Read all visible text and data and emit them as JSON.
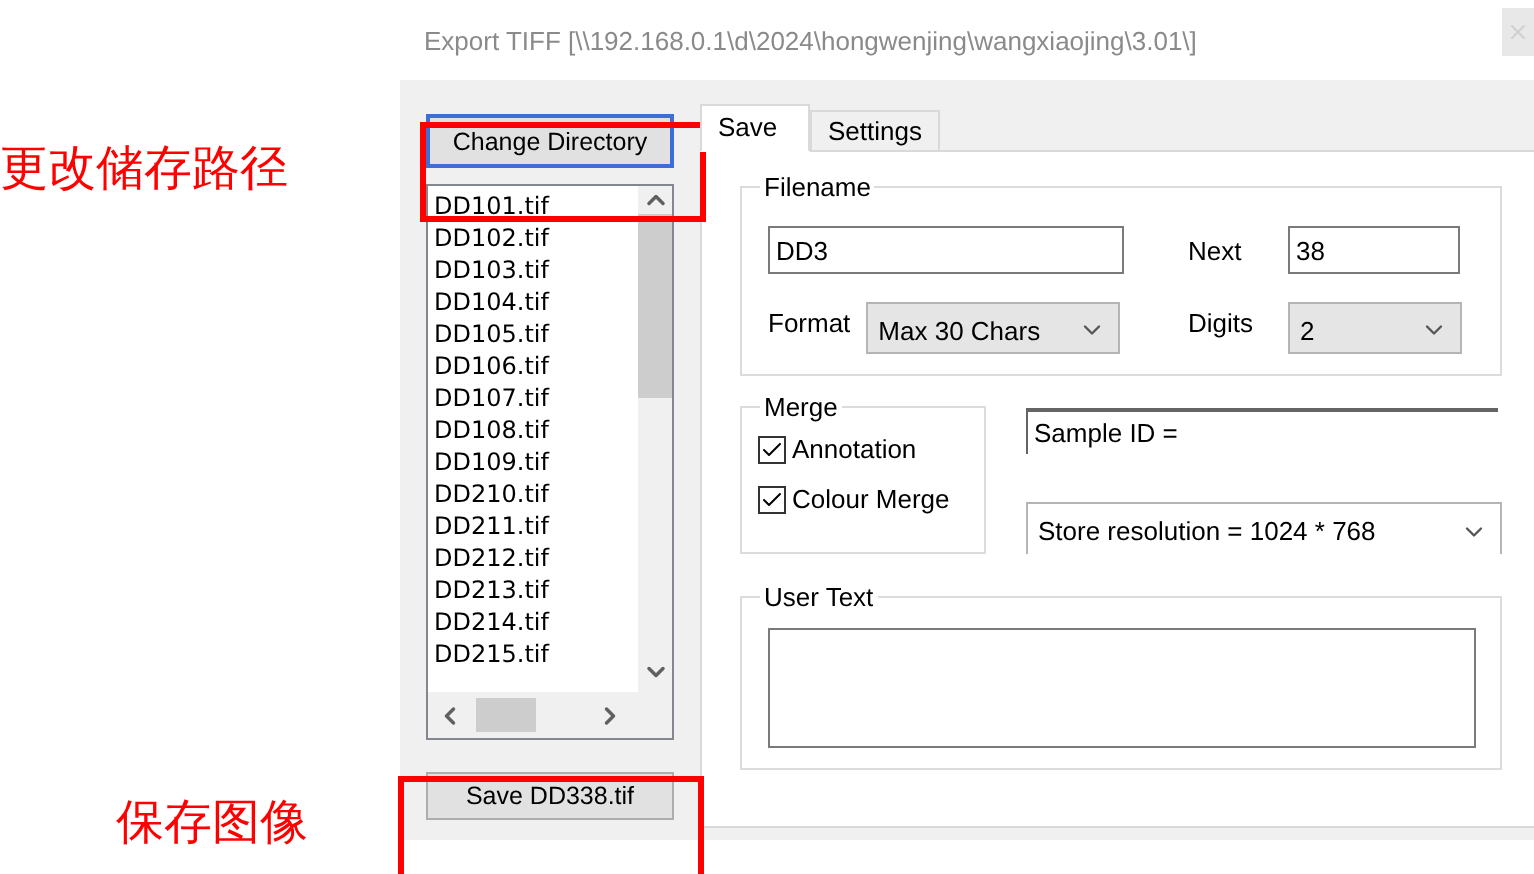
{
  "annotations": [
    {
      "text": "更改储存路径"
    },
    {
      "text": "保存图像"
    }
  ],
  "window": {
    "title": "Export TIFF [\\\\192.168.0.1\\d\\2024\\hongwenjing\\wangxiaojing\\3.01\\]"
  },
  "change_directory_button": "Change Directory",
  "file_list": {
    "items": [
      "DD101.tif",
      "DD102.tif",
      "DD103.tif",
      "DD104.tif",
      "DD105.tif",
      "DD106.tif",
      "DD107.tif",
      "DD108.tif",
      "DD109.tif",
      "DD210.tif",
      "DD211.tif",
      "DD212.tif",
      "DD213.tif",
      "DD214.tif",
      "DD215.tif"
    ]
  },
  "save_button": "Save DD338.tif",
  "tabs": [
    {
      "label": "Save",
      "selected": true
    },
    {
      "label": "Settings",
      "selected": false
    }
  ],
  "filename_group": {
    "legend": "Filename",
    "value": "DD3",
    "next_label": "Next",
    "next_value": "38",
    "format_label": "Format",
    "format_value": "Max 30 Chars",
    "digits_label": "Digits",
    "digits_value": "2"
  },
  "merge_group": {
    "legend": "Merge",
    "options": [
      {
        "label": "Annotation",
        "checked": true
      },
      {
        "label": "Colour Merge",
        "checked": true
      }
    ]
  },
  "sample_id": {
    "value": "Sample ID ="
  },
  "resolution": {
    "value": "Store resolution = 1024 * 768"
  },
  "user_text": {
    "legend": "User Text"
  }
}
